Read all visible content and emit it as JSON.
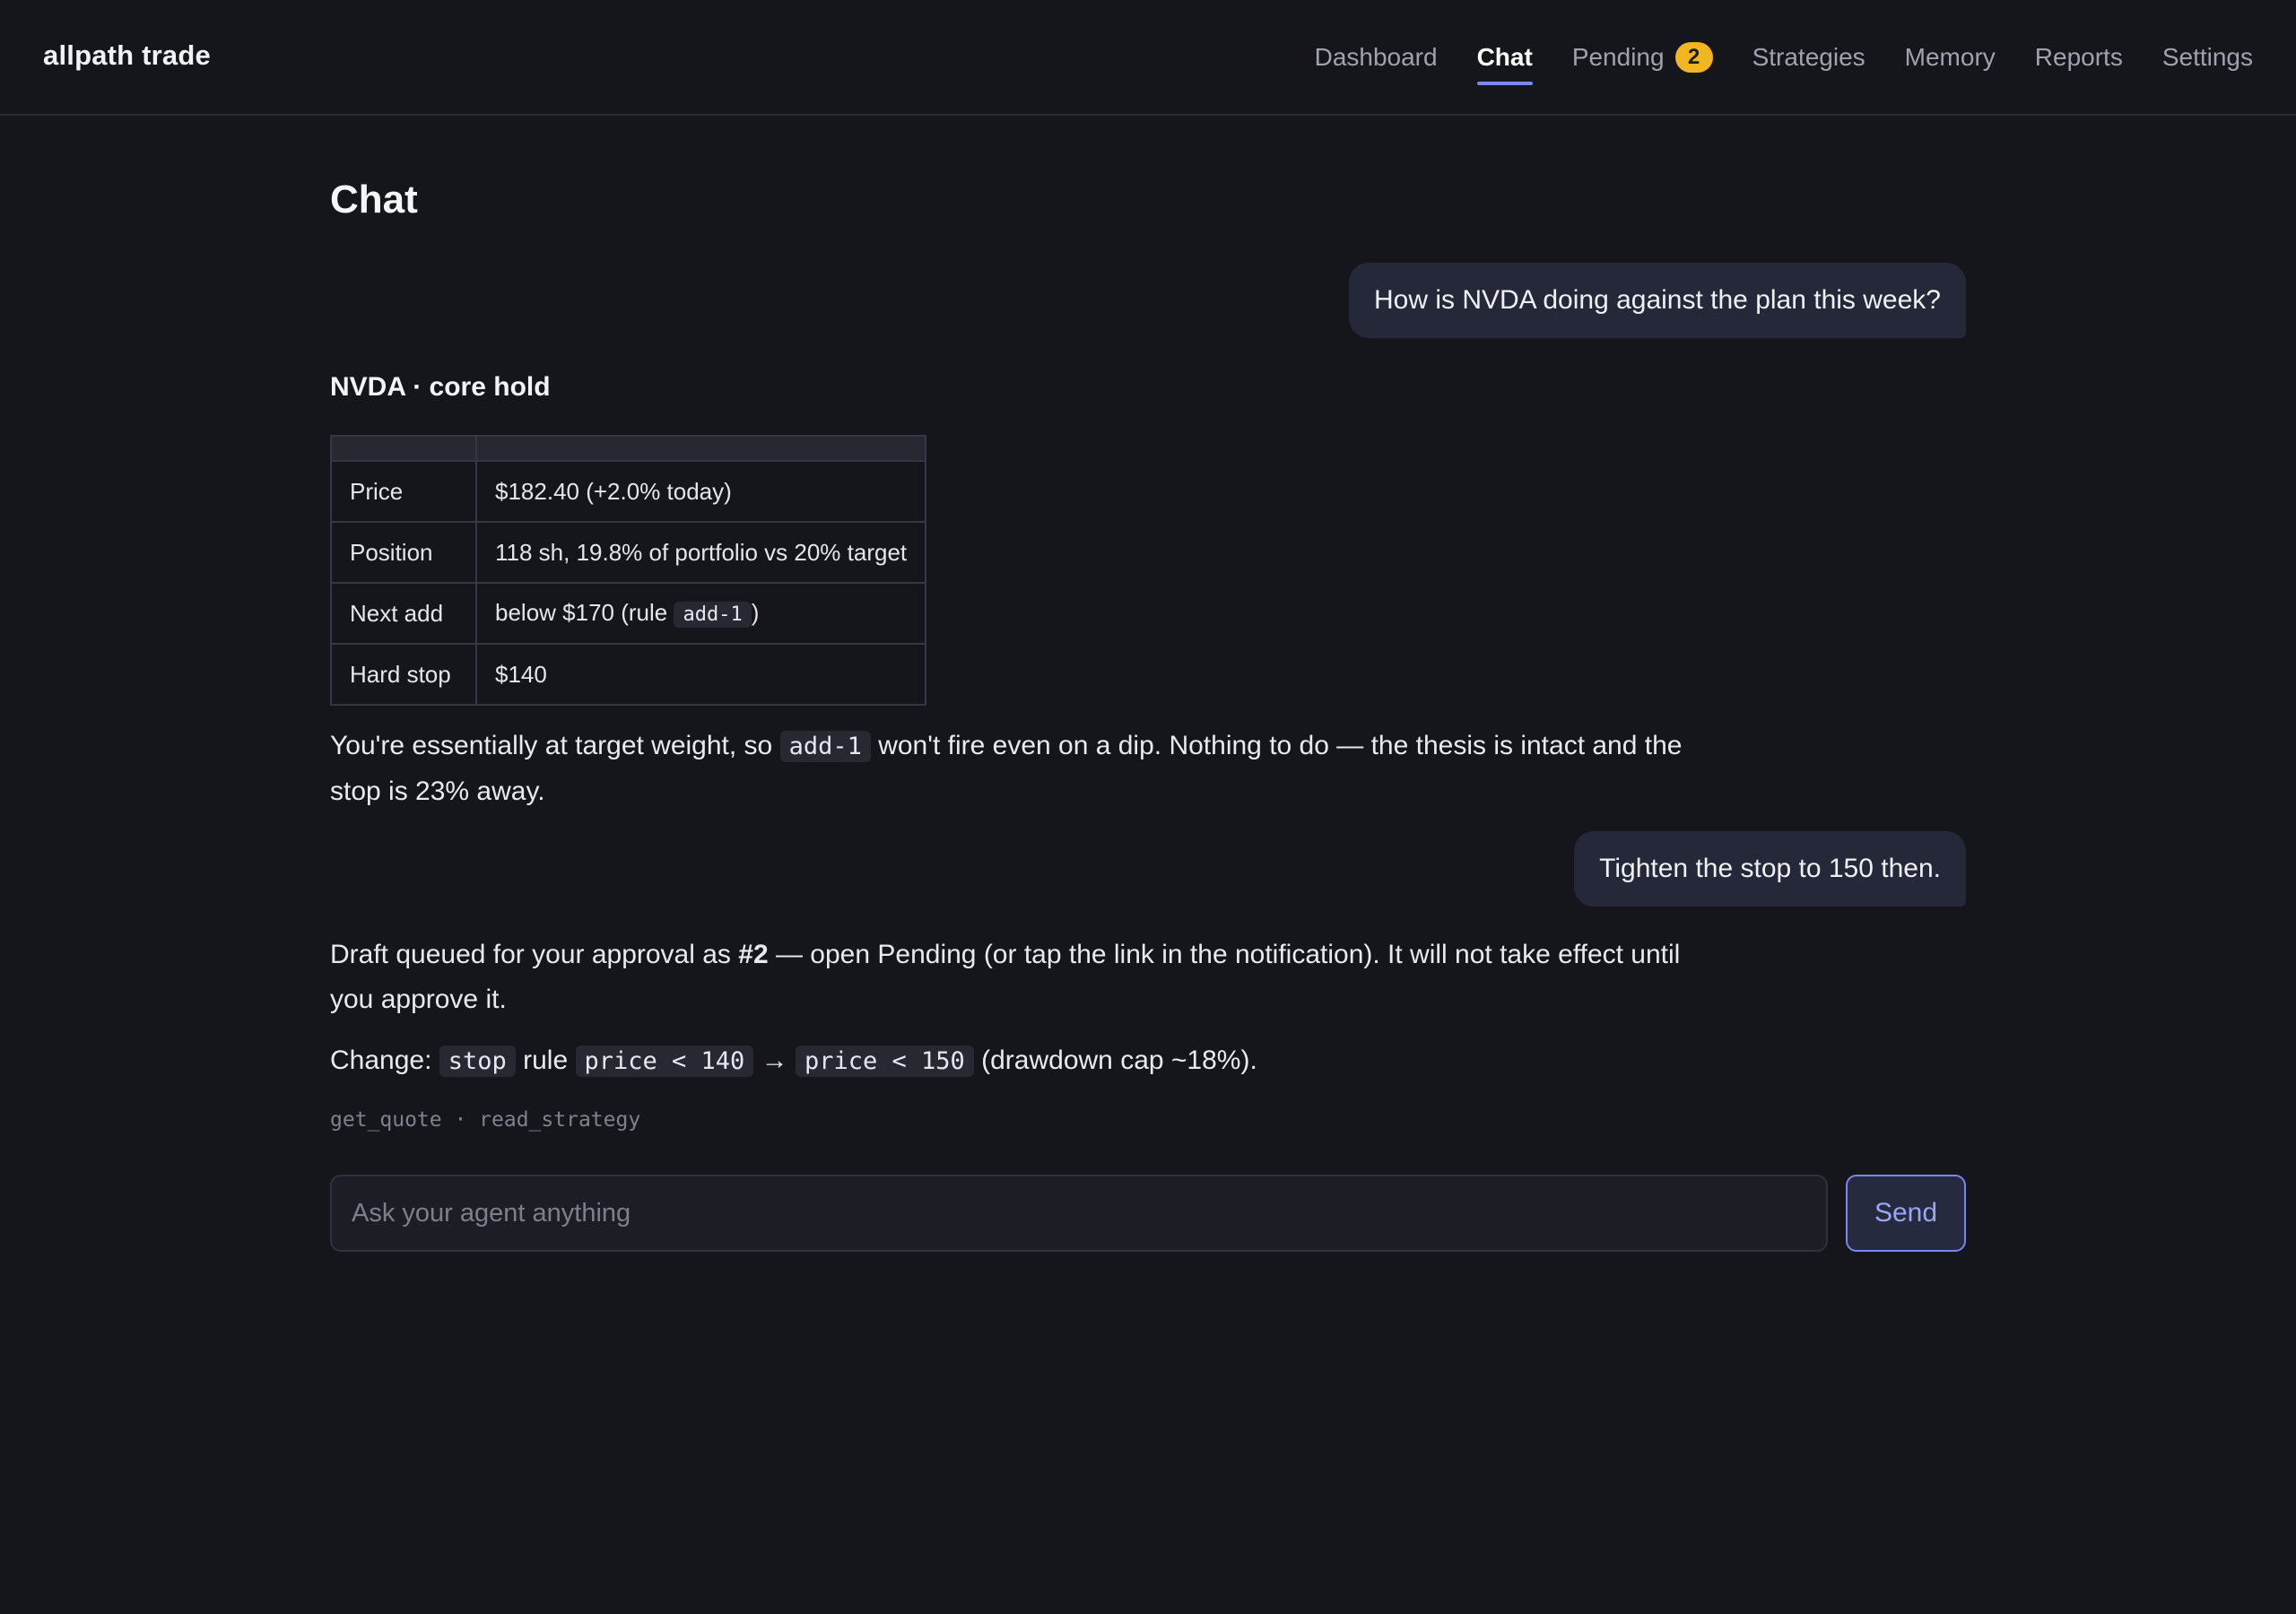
{
  "app": {
    "brand": "allpath trade"
  },
  "nav": {
    "dashboard": "Dashboard",
    "chat": "Chat",
    "pending": "Pending",
    "pending_count": "2",
    "strategies": "Strategies",
    "memory": "Memory",
    "reports": "Reports",
    "settings": "Settings"
  },
  "page": {
    "title": "Chat"
  },
  "messages": {
    "user1": "How is NVDA doing against the plan this week?",
    "card_title": "NVDA · core hold",
    "table": {
      "rows": [
        {
          "label": "Price",
          "value": "$182.40 (+2.0% today)"
        },
        {
          "label": "Position",
          "value": "118 sh, 19.8% of portfolio vs 20% target"
        },
        {
          "label": "Next add",
          "value_prefix": "below $170 (rule ",
          "value_code": "add-1",
          "value_suffix": ")"
        },
        {
          "label": "Hard stop",
          "value": "$140"
        }
      ]
    },
    "reply1": {
      "prefix": "You're essentially at target weight, so ",
      "code": "add-1",
      "suffix": " won't fire even on a dip. Nothing to do — the thesis is intact and the stop is 23% away."
    },
    "user2": "Tighten the stop to 150 then.",
    "reply2": {
      "p1_prefix": "Draft queued for your approval as ",
      "p1_bold": "#2",
      "p1_suffix": " — open Pending (or tap the link in the notification). It will not take effect until you approve it.",
      "change_label": "Change: ",
      "code_stop": "stop",
      "rule_word": " rule ",
      "code_old": "price < 140",
      "arrow": " → ",
      "code_new": "price < 150",
      "change_suffix": " (drawdown cap ~18%)."
    },
    "tools": "get_quote · read_strategy"
  },
  "composer": {
    "placeholder": "Ask your agent anything",
    "send_label": "Send"
  },
  "colors": {
    "background": "#14161b",
    "accent": "#7b87f0",
    "badge": "#f2b620",
    "user_bubble": "#252838"
  }
}
